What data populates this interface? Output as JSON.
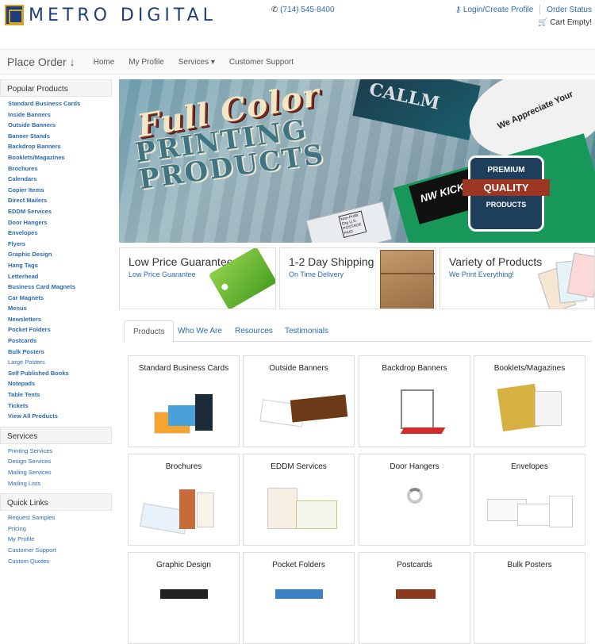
{
  "header": {
    "logo_text": "METRO DIGITAL",
    "phone": "(714) 545-8400",
    "login_label": "Login/Create Profile",
    "order_status_label": "Order Status",
    "cart_label": "Cart Empty!"
  },
  "nav": {
    "place_order": "Place Order ↓",
    "home": "Home",
    "my_profile": "My Profile",
    "services": "Services ▾",
    "support": "Customer Support"
  },
  "sidebar": {
    "popular_title": "Popular Products",
    "popular": [
      "Standard Business Cards",
      "Inside Banners",
      "Outside Banners",
      "Banner Stands",
      "Backdrop Banners",
      "Booklets/Magazines",
      "Brochures",
      "Calendars",
      "Copier Items",
      "Direct Mailers",
      "EDDM Services",
      "Door Hangers",
      "Envelopes",
      "Flyers",
      "Graphic Design",
      "Hang Tags",
      "Letterhead",
      "Business Card Magnets",
      "Car Magnets",
      "Menus",
      "Newsletters",
      "Pocket Folders",
      "Postcards",
      "Bulk Posters",
      "Large Posters",
      "Self Published Books",
      "Notepads",
      "Table Tents",
      "Tickets",
      "View All Products"
    ],
    "services_title": "Services",
    "services": [
      "Printing Services",
      "Design Services",
      "Mailing Services",
      "Mailing Lists"
    ],
    "quick_title": "Quick Links",
    "quick": [
      "Request Samples",
      "Pricing",
      "My Profile",
      "Customer Support",
      "Custom Quotes"
    ]
  },
  "banner": {
    "line1": "Full Color",
    "line2": "PRINTING",
    "line3": "PRODUCTS",
    "card_text": "CALLM",
    "sticker_text": "We Appreciate Your",
    "kickers": "NW KICKERS",
    "badge_top": "PREMIUM",
    "badge_mid": "QUALITY",
    "badge_bot": "PRODUCTS",
    "mail_text": "Non-Profit Org U.S. POSTAGE PAID"
  },
  "features": [
    {
      "title": "Low Price Guarantee",
      "sub": "Low Price Guarantee"
    },
    {
      "title": "1-2 Day Shipping",
      "sub": "On Time Delivery"
    },
    {
      "title": "Variety of Products",
      "sub": "We Print Everything!"
    }
  ],
  "tabs": [
    "Products",
    "Who We Are",
    "Resources",
    "Testimonials"
  ],
  "products": [
    "Standard Business Cards",
    "Outside Banners",
    "Backdrop Banners",
    "Booklets/Magazines",
    "Brochures",
    "EDDM Services",
    "Door Hangers",
    "Envelopes",
    "Graphic Design",
    "Pocket Folders",
    "Postcards",
    "Bulk Posters"
  ],
  "colors": {
    "link": "#2a6ab3",
    "brand": "#1f3f7a",
    "nav_bg": "#f8f8f8"
  },
  "icons": {
    "phone": "phone-icon",
    "login": "user-icon",
    "cart": "cart-icon"
  }
}
